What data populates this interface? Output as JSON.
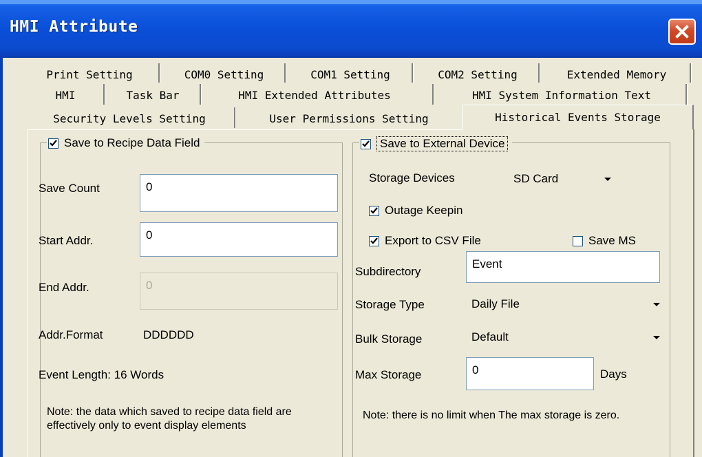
{
  "window": {
    "title": "HMI Attribute"
  },
  "tabs": {
    "row1": [
      "Print Setting",
      "COM0 Setting",
      "COM1 Setting",
      "COM2 Setting",
      "Extended Memory"
    ],
    "row2": [
      "HMI",
      "Task Bar",
      "HMI Extended Attributes",
      "HMI System Information Text"
    ],
    "row3": [
      "Security Levels Setting",
      "User Permissions Setting",
      "Historical Events Storage"
    ],
    "active": "Historical Events Storage"
  },
  "recipe_group": {
    "checkbox_label": "Save to Recipe Data Field",
    "checked": true,
    "save_count_label": "Save Count",
    "save_count_value": "0",
    "start_addr_label": "Start Addr.",
    "start_addr_value": "0",
    "end_addr_label": "End Addr.",
    "end_addr_value": "0",
    "addr_format_label": "Addr.Format",
    "addr_format_value": "DDDDDD",
    "event_length": "Event Length: 16 Words",
    "note": "Note: the data which saved to recipe data field are effectively only to event display elements"
  },
  "external_group": {
    "checkbox_label": "Save to External Device",
    "checked": true,
    "storage_devices_label": "Storage Devices",
    "storage_devices_value": "SD Card",
    "outage_keepin_label": "Outage Keepin",
    "outage_keepin_checked": true,
    "export_csv_label": "Export to CSV File",
    "export_csv_checked": true,
    "save_ms_label": "Save MS",
    "save_ms_checked": false,
    "subdirectory_label": "Subdirectory",
    "subdirectory_value": "Event",
    "storage_type_label": "Storage Type",
    "storage_type_value": "Daily File",
    "bulk_storage_label": "Bulk Storage",
    "bulk_storage_value": "Default",
    "max_storage_label": "Max Storage",
    "max_storage_value": "0",
    "max_storage_unit": "Days",
    "note": "Note: there is no limit when The max storage is zero."
  },
  "colors": {
    "titlebar": "#0a4fd8",
    "dialog_face": "#ECE9D8",
    "close_button": "#d04a25"
  }
}
